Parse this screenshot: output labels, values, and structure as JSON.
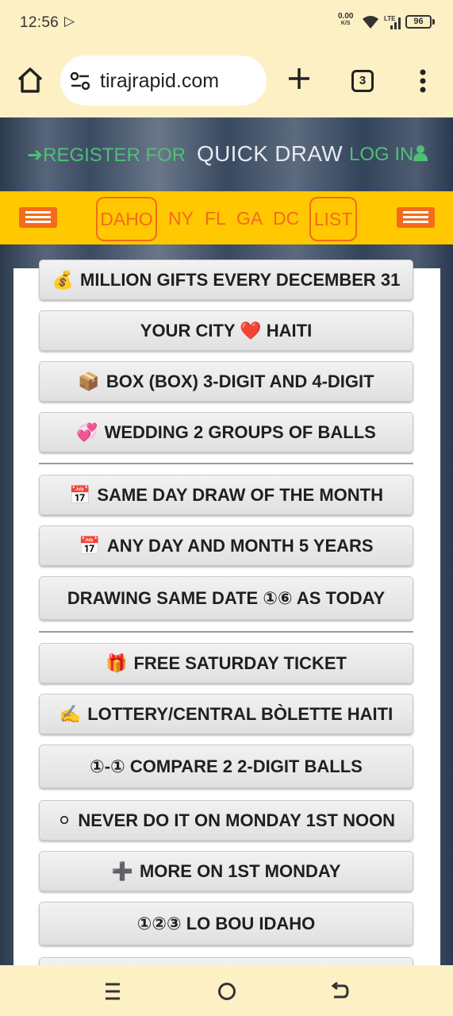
{
  "status_bar": {
    "time": "12:56",
    "net_speed": "0.00",
    "net_unit": "K/S",
    "network_type": "LTE",
    "battery": "96"
  },
  "browser": {
    "url": "tirajrapid.com",
    "tab_count": "3"
  },
  "site_header": {
    "register": "REGISTER FOR",
    "title": "QUICK DRAW",
    "login": "LOG IN"
  },
  "nav": {
    "items": [
      "DAHO",
      "NY",
      "FL",
      "GA",
      "DC",
      "LIST"
    ]
  },
  "menu": {
    "items": [
      {
        "icon": "💰",
        "label": "MILLION GIFTS EVERY DECEMBER 31"
      },
      {
        "icon": "",
        "label": "YOUR CITY ❤️ HAITI"
      },
      {
        "icon": "📦",
        "label": "BOX (BOX) 3-DIGIT AND 4-DIGIT"
      },
      {
        "icon": "💞",
        "label": "WEDDING 2 GROUPS OF BALLS"
      },
      {
        "icon": "📅",
        "label": "SAME DAY DRAW OF THE MONTH"
      },
      {
        "icon": "📅",
        "label": "ANY DAY AND MONTH 5 YEARS"
      },
      {
        "icon": "",
        "label": "DRAWING SAME DATE ①⑥ AS TODAY"
      },
      {
        "icon": "🎁",
        "label": "FREE SATURDAY TICKET"
      },
      {
        "icon": "✍️",
        "label": "LOTTERY/CENTRAL BÒLETTE HAITI"
      },
      {
        "icon": "",
        "label": "①-① COMPARE 2 2-DIGIT BALLS"
      },
      {
        "icon": "⚪",
        "label": "NEVER DO IT ON MONDAY 1ST NOON"
      },
      {
        "icon": "➕",
        "label": "MORE ON 1ST MONDAY"
      },
      {
        "icon": "",
        "label": "①②③ LO BOU IDAHO"
      }
    ]
  },
  "colors": {
    "browser_bg": "#fdf0c4",
    "accent_green": "#4fbf78",
    "nav_yellow": "#ffc800",
    "nav_orange": "#f26b1b"
  }
}
